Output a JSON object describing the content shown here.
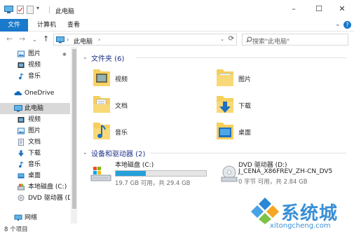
{
  "window": {
    "title": "此电脑",
    "controls": {
      "minimize": "–",
      "maximize": "☐",
      "close": "✕"
    }
  },
  "ribbon": {
    "tabs": [
      "文件",
      "计算机",
      "查看"
    ],
    "expand_glyph": "⌄",
    "help_glyph": "?"
  },
  "address_bar": {
    "back": "←",
    "forward": "→",
    "recent": "⌄",
    "up": "↑",
    "crumb": "此电脑",
    "separator": "›",
    "dropdown": "⌄",
    "refresh": "⟳",
    "search_placeholder": "搜索\"此电脑\""
  },
  "sidebar": {
    "items": [
      {
        "label": "图片",
        "icon": "pictures-icon",
        "pinned": true
      },
      {
        "label": "视频",
        "icon": "videos-icon"
      },
      {
        "label": "音乐",
        "icon": "music-icon"
      },
      {
        "label": "OneDrive",
        "icon": "onedrive-icon"
      },
      {
        "label": "此电脑",
        "icon": "this-pc-icon",
        "selected": true
      },
      {
        "label": "视频",
        "icon": "videos-icon"
      },
      {
        "label": "图片",
        "icon": "pictures-icon"
      },
      {
        "label": "文档",
        "icon": "documents-icon"
      },
      {
        "label": "下载",
        "icon": "downloads-icon"
      },
      {
        "label": "音乐",
        "icon": "music-icon"
      },
      {
        "label": "桌面",
        "icon": "desktop-icon"
      },
      {
        "label": "本地磁盘 (C:)",
        "icon": "local-disk-icon"
      },
      {
        "label": "DVD 驱动器 (D:",
        "icon": "dvd-drive-icon"
      },
      {
        "label": "网络",
        "icon": "network-icon"
      }
    ],
    "pin_glyph": "✱"
  },
  "folders": {
    "heading": "文件夹 (6)",
    "items": [
      {
        "label": "视频",
        "icon": "videos-folder-icon"
      },
      {
        "label": "图片",
        "icon": "pictures-folder-icon"
      },
      {
        "label": "文档",
        "icon": "documents-folder-icon"
      },
      {
        "label": "下载",
        "icon": "downloads-folder-icon"
      },
      {
        "label": "音乐",
        "icon": "music-folder-icon"
      },
      {
        "label": "桌面",
        "icon": "desktop-folder-icon"
      }
    ]
  },
  "devices": {
    "heading": "设备和驱动器 (2)",
    "items": [
      {
        "name": "本地磁盘 (C:)",
        "capacity": "19.7 GB 可用，共 29.4 GB",
        "used_fraction": 0.33,
        "icon": "local-disk-icon"
      },
      {
        "name": "DVD 驱动器 (D:)",
        "sublabel": "J_CENA_X86FREV_ZH-CN_DV5",
        "capacity": "0 字节 可用，共 2.84 GB",
        "icon": "dvd-drive-icon"
      }
    ]
  },
  "status_bar": {
    "count": "8 个项目"
  },
  "watermark": {
    "brand": "系统城",
    "url": "xitongcheng.com"
  },
  "colors": {
    "accent": "#1979ca",
    "heading": "#1e3287",
    "drive_fill": "#26a0da",
    "folder": "#f6cf5c"
  }
}
